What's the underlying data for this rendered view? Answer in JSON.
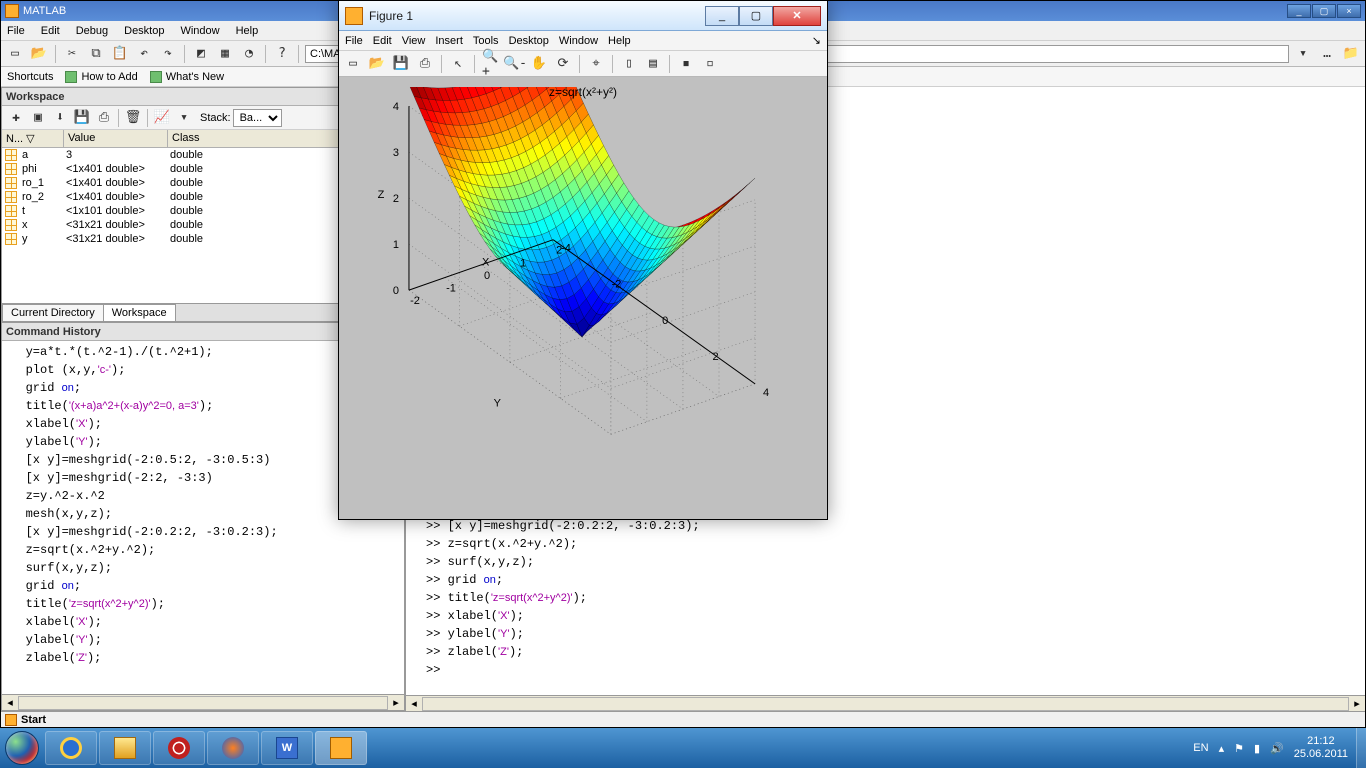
{
  "main_title": "MATLAB",
  "figure_title": "Figure 1",
  "main_menu": [
    "File",
    "Edit",
    "Debug",
    "Desktop",
    "Window",
    "Help"
  ],
  "figure_menu": [
    "File",
    "Edit",
    "View",
    "Insert",
    "Tools",
    "Desktop",
    "Window",
    "Help"
  ],
  "addr_value": "C:\\MATLA",
  "shortcuts_label": "Shortcuts",
  "shortcut_links": [
    "How to Add",
    "What's New"
  ],
  "workspace": {
    "title": "Workspace",
    "stack_label": "Stack:",
    "stack_value": "Ba...",
    "columns": [
      "N...",
      "Value",
      "Class"
    ],
    "rows": [
      {
        "name": "a",
        "value": "3",
        "class": "double"
      },
      {
        "name": "phi",
        "value": "<1x401 double>",
        "class": "double"
      },
      {
        "name": "ro_1",
        "value": "<1x401 double>",
        "class": "double"
      },
      {
        "name": "ro_2",
        "value": "<1x401 double>",
        "class": "double"
      },
      {
        "name": "t",
        "value": "<1x101 double>",
        "class": "double"
      },
      {
        "name": "x",
        "value": "<31x21 double>",
        "class": "double"
      },
      {
        "name": "y",
        "value": "<31x21 double>",
        "class": "double"
      }
    ],
    "tabs": [
      "Current Directory",
      "Workspace"
    ],
    "active_tab": 1
  },
  "history": {
    "title": "Command History",
    "lines": [
      {
        "t": "y=a*t.*(t.^2-1)./(t.^2+1);"
      },
      {
        "t": "plot (x,y,",
        "s": "'c-'",
        "r": ");"
      },
      {
        "t": "grid ",
        "k": "on",
        "r": ";"
      },
      {
        "t": "title(",
        "s": "'(x+a)a^2+(x-a)y^2=0, a=3'",
        "r": ");"
      },
      {
        "t": "xlabel(",
        "s": "'X'",
        "r": ");"
      },
      {
        "t": "ylabel(",
        "s": "'Y'",
        "r": ");"
      },
      {
        "t": "[x y]=meshgrid(-2:0.5:2, -3:0.5:3)"
      },
      {
        "t": "[x y]=meshgrid(-2:2, -3:3)"
      },
      {
        "t": "z=y.^2-x.^2"
      },
      {
        "t": "mesh(x,y,z);"
      },
      {
        "t": "[x y]=meshgrid(-2:0.2:2, -3:0.2:3);"
      },
      {
        "t": "z=sqrt(x.^2+y.^2);"
      },
      {
        "t": "surf(x,y,z);"
      },
      {
        "t": "grid ",
        "k": "on",
        "r": ";"
      },
      {
        "t": "title(",
        "s": "'z=sqrt(x^2+y^2)'",
        "r": ");"
      },
      {
        "t": "xlabel(",
        "s": "'X'",
        "r": ");"
      },
      {
        "t": "ylabel(",
        "s": "'Y'",
        "r": ");"
      },
      {
        "t": "zlabel(",
        "s": "'Z'",
        "r": ");"
      }
    ]
  },
  "command_window": {
    "lines": [
      {
        "p": ">> ",
        "t": "[x y]=meshgrid(-2:0.2:2, -3:0.2:3);"
      },
      {
        "p": ">> ",
        "t": "z=sqrt(x.^2+y.^2);"
      },
      {
        "p": ">> ",
        "t": "surf(x,y,z);"
      },
      {
        "p": ">> ",
        "t": "grid ",
        "k": "on",
        "r": ";"
      },
      {
        "p": ">> ",
        "t": "title(",
        "s": "'z=sqrt(x^2+y^2)'",
        "r": ");"
      },
      {
        "p": ">> ",
        "t": "xlabel(",
        "s": "'X'",
        "r": ");"
      },
      {
        "p": ">> ",
        "t": "ylabel(",
        "s": "'Y'",
        "r": ");"
      },
      {
        "p": ">> ",
        "t": "zlabel(",
        "s": "'Z'",
        "r": ");"
      },
      {
        "p": ">> ",
        "t": ""
      }
    ]
  },
  "plot": {
    "title_html": "z=sqrt(x²+y²)",
    "xlabel": "X",
    "ylabel": "Y",
    "zlabel": "Z",
    "x_ticks": [
      "-2",
      "-1",
      "0",
      "1",
      "2"
    ],
    "y_ticks": [
      "-4",
      "-2",
      "0",
      "2",
      "4"
    ],
    "z_ticks": [
      "0",
      "1",
      "2",
      "3",
      "4"
    ]
  },
  "status_start": "Start",
  "tray": {
    "lang": "EN",
    "time": "21:12",
    "date": "25.06.2011"
  },
  "chart_data": {
    "type": "surface3d",
    "function": "z = sqrt(x^2 + y^2)",
    "title": "z=sqrt(x^2+y^2)",
    "xlabel": "X",
    "ylabel": "Y",
    "zlabel": "Z",
    "xlim": [
      -2,
      2
    ],
    "ylim": [
      -4,
      4
    ],
    "zlim": [
      0,
      4
    ],
    "x_ticks": [
      -2,
      -1,
      0,
      1,
      2
    ],
    "y_ticks": [
      -4,
      -2,
      0,
      2,
      4
    ],
    "z_ticks": [
      0,
      1,
      2,
      3,
      4
    ],
    "x_step": 0.2,
    "y_step": 0.2,
    "colormap": "jet",
    "grid": true
  }
}
